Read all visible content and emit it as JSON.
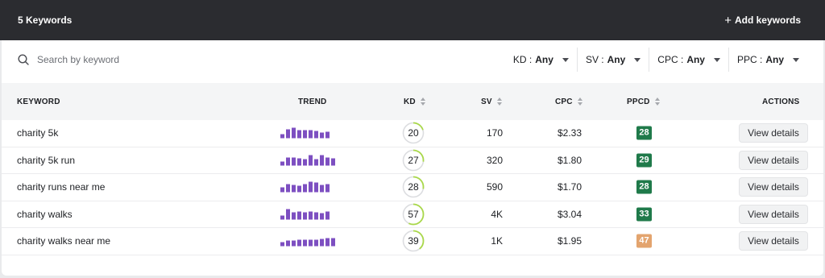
{
  "header": {
    "keyword_count": "5 Keywords",
    "add_label": "Add keywords",
    "add_icon": "+"
  },
  "search": {
    "placeholder": "Search by keyword",
    "value": ""
  },
  "filters": [
    {
      "label": "KD :",
      "value": "Any"
    },
    {
      "label": "SV :",
      "value": "Any"
    },
    {
      "label": "CPC :",
      "value": "Any"
    },
    {
      "label": "PPC :",
      "value": "Any"
    }
  ],
  "table": {
    "columns": {
      "keyword": "KEYWORD",
      "trend": "TREND",
      "kd": "KD",
      "sv": "SV",
      "cpc": "CPC",
      "ppcd": "PPCD",
      "actions": "ACTIONS"
    },
    "action_label": "View details",
    "rows": [
      {
        "keyword": "charity 5k",
        "trend": [
          0.35,
          0.85,
          1.0,
          0.8,
          0.8,
          0.75,
          0.7,
          0.5,
          0.6
        ],
        "kd": "20",
        "kd_value": 20,
        "sv": "170",
        "cpc": "$2.33",
        "ppcd": "28",
        "ppcd_color": "#1f7a4a"
      },
      {
        "keyword": "charity 5k run",
        "trend": [
          0.4,
          0.75,
          0.75,
          0.7,
          0.6,
          1.0,
          0.65,
          1.0,
          0.75,
          0.7
        ],
        "kd": "27",
        "kd_value": 27,
        "sv": "320",
        "cpc": "$1.80",
        "ppcd": "29",
        "ppcd_color": "#1f7a4a"
      },
      {
        "keyword": "charity runs near me",
        "trend": [
          0.45,
          0.75,
          0.7,
          0.65,
          0.75,
          1.0,
          0.9,
          0.7,
          0.8
        ],
        "kd": "28",
        "kd_value": 28,
        "sv": "590",
        "cpc": "$1.70",
        "ppcd": "28",
        "ppcd_color": "#1f7a4a"
      },
      {
        "keyword": "charity walks",
        "trend": [
          0.4,
          1.0,
          0.7,
          0.8,
          0.7,
          0.75,
          0.7,
          0.65,
          0.75
        ],
        "kd": "57",
        "kd_value": 57,
        "sv": "4K",
        "cpc": "$3.04",
        "ppcd": "33",
        "ppcd_color": "#1f7a4a"
      },
      {
        "keyword": "charity walks near me",
        "trend": [
          0.35,
          0.5,
          0.55,
          0.6,
          0.6,
          0.65,
          0.65,
          0.7,
          0.75,
          0.8
        ],
        "kd": "39",
        "kd_value": 39,
        "sv": "1K",
        "cpc": "$1.95",
        "ppcd": "47",
        "ppcd_color": "#e3a46e"
      }
    ]
  },
  "colors": {
    "topbar": "#2b2c30",
    "trend_bar": "#7d4fc1",
    "kd_ring": "#a9d84a",
    "kd_track": "#dcdde0"
  }
}
